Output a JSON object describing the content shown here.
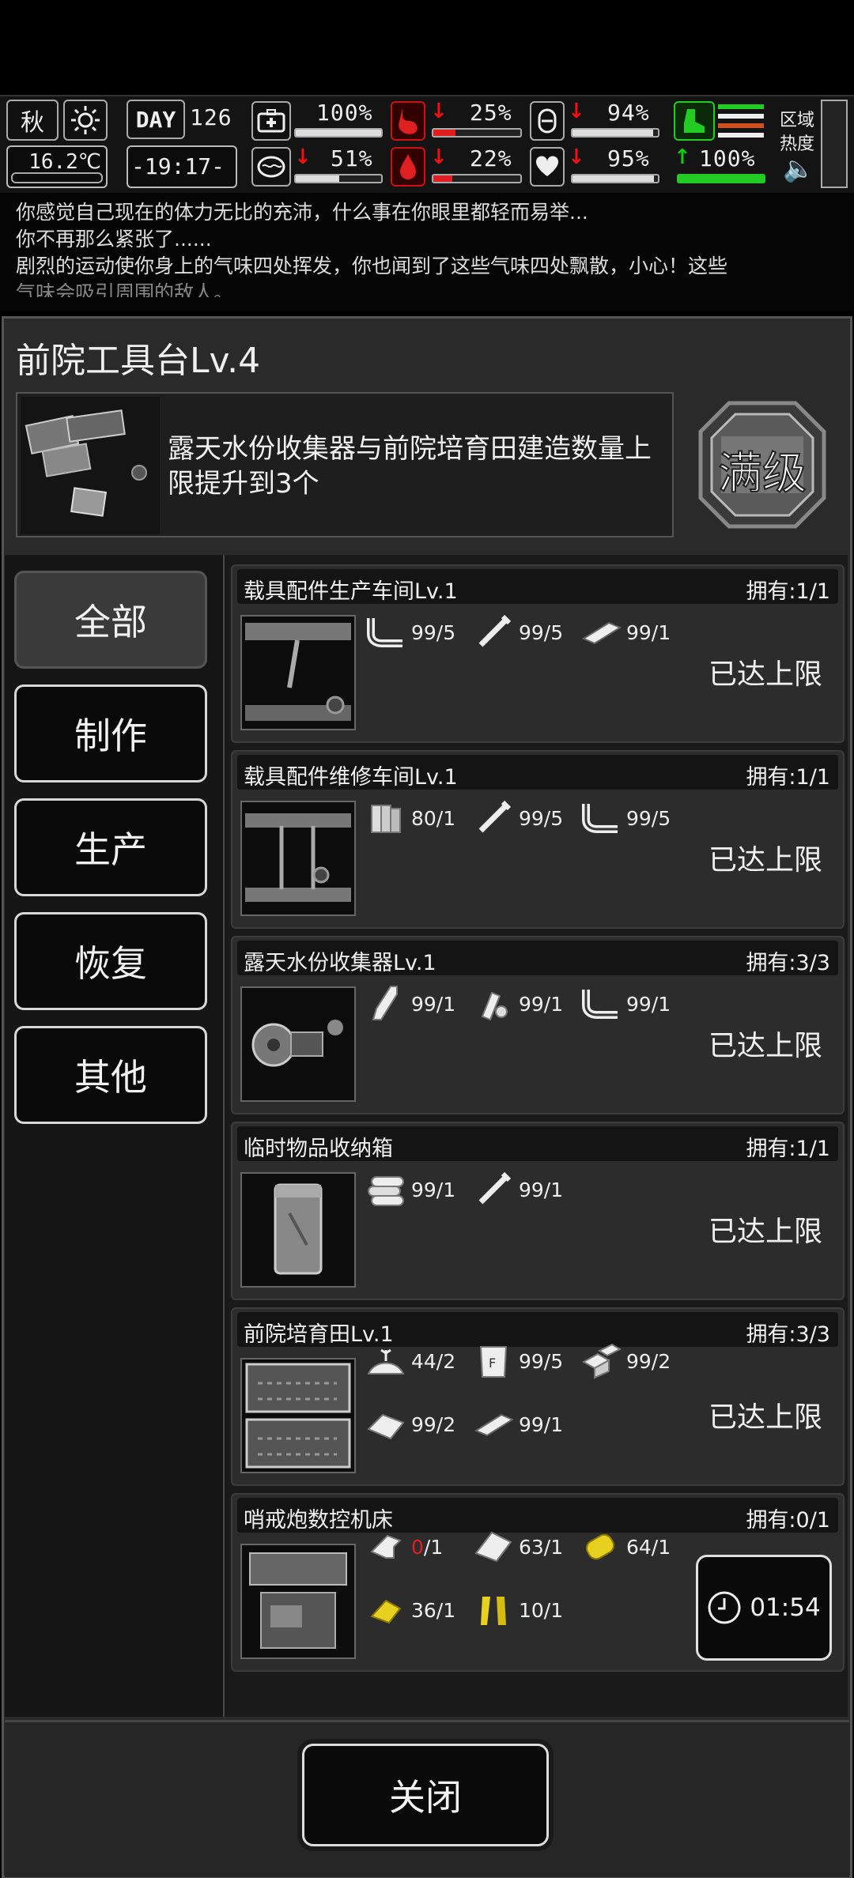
{
  "hud": {
    "season": "秋",
    "temperature": "16.2℃",
    "day_label": "DAY",
    "day": "126",
    "clock": "-19:17-",
    "zone_label_1": "区域",
    "zone_label_2": "热度",
    "stats": {
      "health": {
        "text": "100%",
        "level": 1.0
      },
      "hunger": {
        "text": "25%",
        "level": 0.25
      },
      "water_bag": {
        "text": "94%",
        "level": 0.94
      },
      "mind": {
        "text": "51%",
        "level": 0.51
      },
      "thirst": {
        "text": "22%",
        "level": 0.22
      },
      "mood": {
        "text": "95%",
        "level": 0.95
      },
      "stamina": {
        "text": "100%",
        "level": 1.0
      }
    },
    "colors": {
      "danger": "#e02020",
      "good": "#22cc22",
      "panel": "#2a2a2a"
    }
  },
  "log": [
    "你感觉自己现在的体力无比的充沛，什么事在你眼里都轻而易举...",
    "你不再那么紧张了......",
    "剧烈的运动使你身上的气味四处挥发，你也闻到了这些气味四处飘散，小心！这些",
    "气味会吸引周围的敌人。"
  ],
  "workbench": {
    "title": "前院工具台Lv.4",
    "description": "露天水份收集器与前院培育田建造数量上限提升到3个",
    "badge": "满级"
  },
  "categories": [
    {
      "label": "全部",
      "active": true
    },
    {
      "label": "制作",
      "active": false
    },
    {
      "label": "生产",
      "active": false
    },
    {
      "label": "恢复",
      "active": false
    },
    {
      "label": "其他",
      "active": false
    }
  ],
  "recipes": [
    {
      "name": "载具配件生产车间Lv.1",
      "owned": "拥有:1/1",
      "status": "已达上限",
      "materials": [
        {
          "icon": "pipe-icon",
          "value": "99/5"
        },
        {
          "icon": "screw-icon",
          "value": "99/5"
        },
        {
          "icon": "steel-plate-icon",
          "value": "99/1"
        }
      ]
    },
    {
      "name": "载具配件维修车间Lv.1",
      "owned": "拥有:1/1",
      "status": "已达上限",
      "materials": [
        {
          "icon": "wood-icon",
          "value": "80/1"
        },
        {
          "icon": "screw-icon",
          "value": "99/5"
        },
        {
          "icon": "pipe-icon",
          "value": "99/5"
        }
      ]
    },
    {
      "name": "露天水份收集器Lv.1",
      "owned": "拥有:3/3",
      "status": "已达上限",
      "materials": [
        {
          "icon": "bottle-icon",
          "value": "99/1"
        },
        {
          "icon": "tape-icon",
          "value": "99/1"
        },
        {
          "icon": "pipe-icon",
          "value": "99/1"
        }
      ]
    },
    {
      "name": "临时物品收纳箱",
      "owned": "拥有:1/1",
      "status": "已达上限",
      "materials": [
        {
          "icon": "log-icon",
          "value": "99/1"
        },
        {
          "icon": "screw-icon",
          "value": "99/1"
        }
      ]
    },
    {
      "name": "前院培育田Lv.1",
      "owned": "拥有:3/3",
      "status": "已达上限",
      "materials": [
        {
          "icon": "soil-icon",
          "value": "44/2"
        },
        {
          "icon": "fertilizer-icon",
          "value": "99/5"
        },
        {
          "icon": "bricks-icon",
          "value": "99/2"
        },
        {
          "icon": "cloth-icon",
          "value": "99/2"
        },
        {
          "icon": "steel-plate-icon",
          "value": "99/1"
        }
      ]
    },
    {
      "name": "哨戒炮数控机床",
      "owned": "拥有:0/1",
      "timer": "01:54",
      "materials": [
        {
          "icon": "gun-part-icon",
          "have": "0",
          "need": "/1",
          "lacking": true
        },
        {
          "icon": "metal-sheet-icon",
          "value": "63/1"
        },
        {
          "icon": "spring-icon",
          "value": "64/1"
        },
        {
          "icon": "circuit-icon",
          "value": "36/1"
        },
        {
          "icon": "gold-tape-icon",
          "value": "10/1"
        }
      ]
    }
  ],
  "close_label": "关闭"
}
